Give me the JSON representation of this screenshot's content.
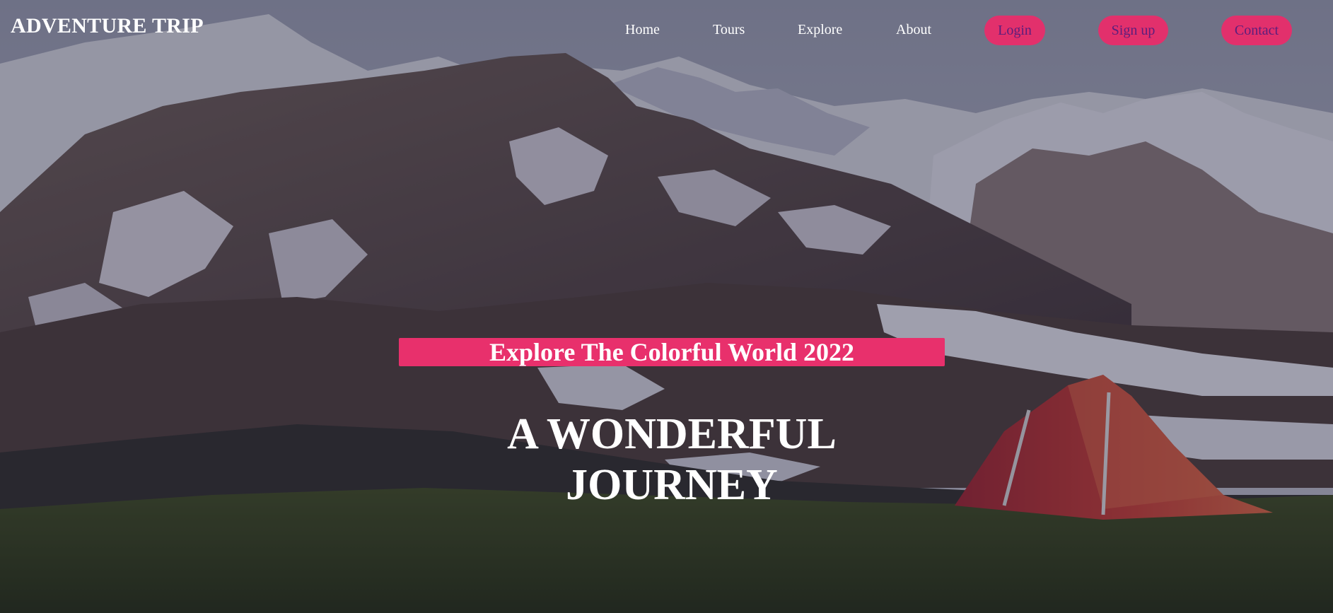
{
  "brand": {
    "title": "ADVENTURE TRIP"
  },
  "nav": {
    "links": [
      {
        "label": "Home"
      },
      {
        "label": "Tours"
      },
      {
        "label": "Explore"
      },
      {
        "label": "About"
      }
    ],
    "buttons": [
      {
        "label": "Login"
      },
      {
        "label": "Sign up"
      },
      {
        "label": "Contact"
      }
    ]
  },
  "hero": {
    "tagline": "Explore The Colorful World 2022",
    "headline": "A WONDERFUL JOURNEY",
    "background_icon": "mountain-landscape-with-tent"
  },
  "colors": {
    "accent": "#e8306c",
    "button_text": "#5b1e7c",
    "text": "#ffffff"
  }
}
